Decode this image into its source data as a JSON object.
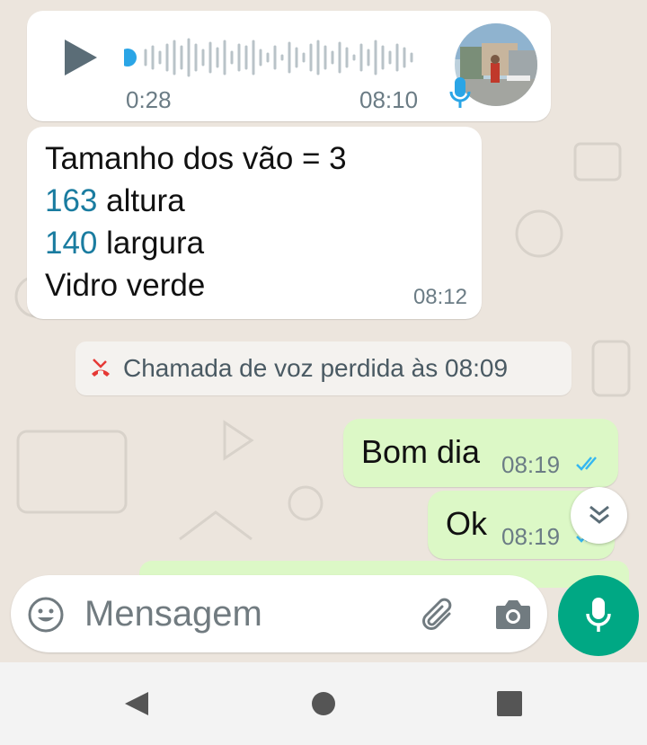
{
  "audio_message": {
    "duration": "0:28",
    "time": "08:10"
  },
  "text_message": {
    "lines": [
      {
        "number": "",
        "text": "Tamanho dos vão = 3"
      },
      {
        "number": "163",
        "text": " altura"
      },
      {
        "number": "140",
        "text": " largura"
      },
      {
        "number": "",
        "text": "Vidro verde"
      }
    ],
    "time": "08:12"
  },
  "missed_call": {
    "text": "Chamada de voz perdida às 08:09"
  },
  "outgoing": [
    {
      "text": "Bom dia",
      "time": "08:19"
    },
    {
      "text": "Ok",
      "time": "08:19"
    }
  ],
  "input": {
    "placeholder": "Mensagem"
  },
  "colors": {
    "chat_background": "#ece5dd",
    "incoming_bubble": "#ffffff",
    "outgoing_bubble": "#dcf8c6",
    "accent": "#00a884",
    "link_number": "#1a7ca0",
    "read_ticks": "#34b7f1",
    "missed_call_icon": "#e53935"
  },
  "icons": [
    "play-icon",
    "microphone-icon",
    "missed-call-icon",
    "double-check-icon",
    "chevrons-down-icon",
    "emoji-icon",
    "attach-icon",
    "camera-icon",
    "back-icon",
    "home-icon",
    "recents-icon"
  ]
}
